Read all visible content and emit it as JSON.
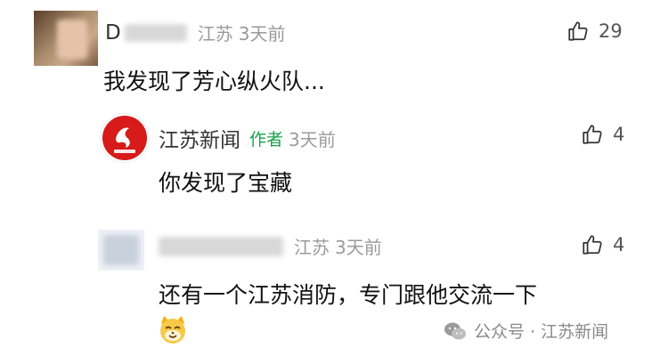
{
  "comments": [
    {
      "name": "D",
      "location": "江苏",
      "time": "3天前",
      "likes": "29",
      "text": "我发现了芳心纵火队..."
    },
    {
      "name": "江苏新闻",
      "author_tag": "作者",
      "time": "3天前",
      "likes": "4",
      "text": "你发现了宝藏"
    },
    {
      "location": "江苏",
      "time": "3天前",
      "likes": "4",
      "text": "还有一个江苏消防，专门跟他交流一下"
    }
  ],
  "watermark": {
    "label": "公众号 · 江苏新闻"
  },
  "colors": {
    "author_tag": "#18a34a",
    "brand_red": "#d71a1a",
    "meta_gray": "#9a9a9a"
  },
  "icons": {
    "like": "thumbs-up-icon",
    "emoji": "cat-emoji-icon",
    "watermark": "wechat-icon"
  }
}
